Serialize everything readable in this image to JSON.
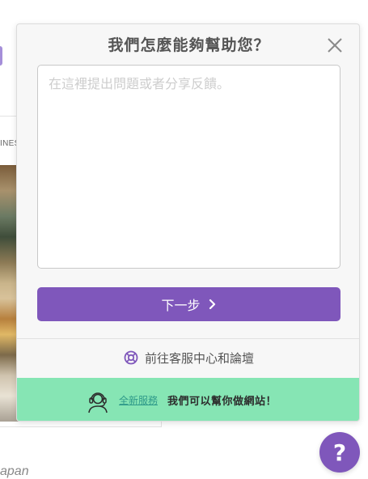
{
  "background": {
    "card_tag": "INES",
    "caption": "apan"
  },
  "widget": {
    "title": "我們怎麼能夠幫助您？",
    "message_placeholder": "在這裡提出問題或者分享反饋。",
    "message_value": "",
    "next_label": "下一步",
    "help_center_label": "前往客服中心和論壇",
    "promo": {
      "link_label": "全新服務",
      "text": "我們可以幫你做網站！"
    }
  },
  "fab": {
    "label": "?"
  },
  "colors": {
    "accent": "#7f57bb",
    "promo_bg": "#86e5b4",
    "promo_link": "#2f9a8a"
  },
  "icons": {
    "close": "close-icon",
    "next": "chevron-right-icon",
    "help_center": "lifebuoy-icon",
    "promo": "headset-agent-icon",
    "fab": "question-mark-icon"
  }
}
